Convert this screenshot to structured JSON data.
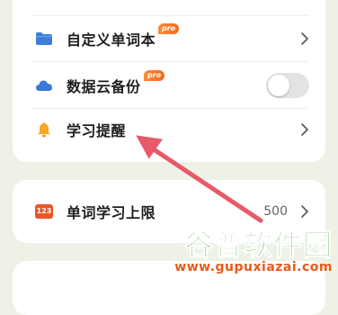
{
  "settings_card": {
    "items": [
      {
        "label": "自定义单词本",
        "badge": "pro",
        "icon": "folder-icon",
        "control": "chevron"
      },
      {
        "label": "数据云备份",
        "badge": "pro",
        "icon": "cloud-icon",
        "control": "toggle",
        "toggle_on": false
      },
      {
        "label": "学习提醒",
        "icon": "bell-icon",
        "control": "chevron"
      }
    ]
  },
  "limit_card": {
    "label": "单词学习上限",
    "icon_text": "123",
    "value": "500"
  },
  "watermark": {
    "title": "谷普软件园",
    "url": "www.gupuxiazai.com"
  },
  "colors": {
    "background": "#eef2e6",
    "folder": "#3f7ed8",
    "cloud": "#3a78d4",
    "bell": "#f5a623",
    "badge": "#f26b1d",
    "arrow": "#e85a6a"
  }
}
